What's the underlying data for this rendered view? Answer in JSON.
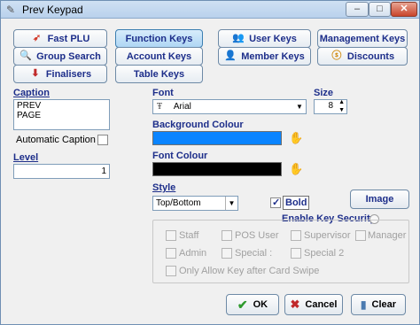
{
  "window": {
    "title": "Prev Keypad"
  },
  "key_buttons": [
    {
      "label": "Fast PLU",
      "icon": "rocket-icon"
    },
    {
      "label": "Function Keys",
      "icon": "",
      "active": true
    },
    {
      "label": "User Keys",
      "icon": "users-icon"
    },
    {
      "label": "Management Keys",
      "icon": ""
    },
    {
      "label": "Group Search",
      "icon": "search-icon"
    },
    {
      "label": "Account Keys",
      "icon": ""
    },
    {
      "label": "Member Keys",
      "icon": "member-icon"
    },
    {
      "label": "Discounts",
      "icon": "discount-icon"
    },
    {
      "label": "Finalisers",
      "icon": "finaliser-icon"
    },
    {
      "label": "Table Keys",
      "icon": ""
    }
  ],
  "caption": {
    "label": "Caption",
    "lines": [
      "PREV",
      "PAGE"
    ],
    "auto_label": "Automatic Caption"
  },
  "level": {
    "label": "Level",
    "value": "1"
  },
  "font": {
    "label": "Font",
    "value": "Arial"
  },
  "size": {
    "label": "Size",
    "value": "8"
  },
  "background_colour": {
    "label": "Background Colour",
    "color": "#0a84ff"
  },
  "font_colour": {
    "label": "Font Colour",
    "color": "#000000"
  },
  "style": {
    "label": "Style",
    "value": "Top/Bottom",
    "bold_label": "Bold",
    "bold_checked": true
  },
  "image_button": "Image",
  "security": {
    "label": "Enable Key Security",
    "options": [
      "Staff",
      "POS User",
      "Supervisor",
      "Manager",
      "Admin",
      "Special :",
      "Special 2"
    ],
    "swipe_label": "Only Allow Key after Card Swipe"
  },
  "buttons": {
    "ok": "OK",
    "cancel": "Cancel",
    "clear": "Clear"
  },
  "colors": {
    "label_blue": "#1d2e8a",
    "ok_green": "#2e9a2e",
    "cancel_red": "#c0282a"
  }
}
